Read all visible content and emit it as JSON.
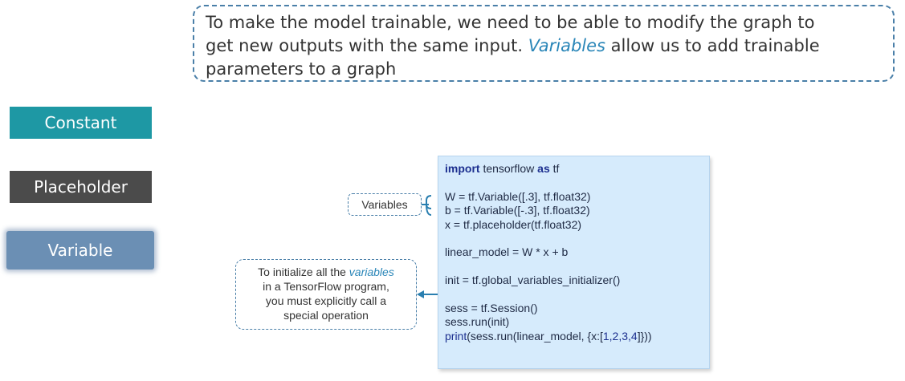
{
  "intro": {
    "line1": "To make the model trainable, we need to be able to modify the graph to",
    "line2_pre": "get new outputs with the same input. ",
    "line2_em": "Variables",
    "line2_post": " allow  us to add trainable",
    "line3": "parameters to a graph"
  },
  "sidebar": {
    "constant": "Constant",
    "placeholder": "Placeholder",
    "variable": "Variable"
  },
  "callouts": {
    "variables_label": "Variables",
    "init_line1_pre": "To initialize all the ",
    "init_line1_em": "variables",
    "init_line2": "in a TensorFlow program,",
    "init_line3": "you must explicitly call a",
    "init_line4": "special operation"
  },
  "code": {
    "l1_kw1": "import",
    "l1_mid": " tensorflow ",
    "l1_kw2": "as",
    "l1_end": " tf",
    "l2": "W = tf.Variable([.3], tf.float32)",
    "l3": "b = tf.Variable([-.3], tf.float32)",
    "l4": "x = tf.placeholder(tf.float32)",
    "l5": "linear_model = W * x + b",
    "l6": "init = tf.global_variables_initializer()",
    "l7": "sess = tf.Session()",
    "l8": "sess.run(init)",
    "l9_fn": "print",
    "l9_mid": "(sess.run(linear_model, {x:[",
    "l9_nums": "1,2,3,4",
    "l9_end": "]}))"
  },
  "colors": {
    "constant": "#1e98a4",
    "placeholder": "#4b4b4b",
    "variable": "#6b8fb4",
    "code_bg": "#d6ebfc",
    "accent": "#2a86b8"
  }
}
